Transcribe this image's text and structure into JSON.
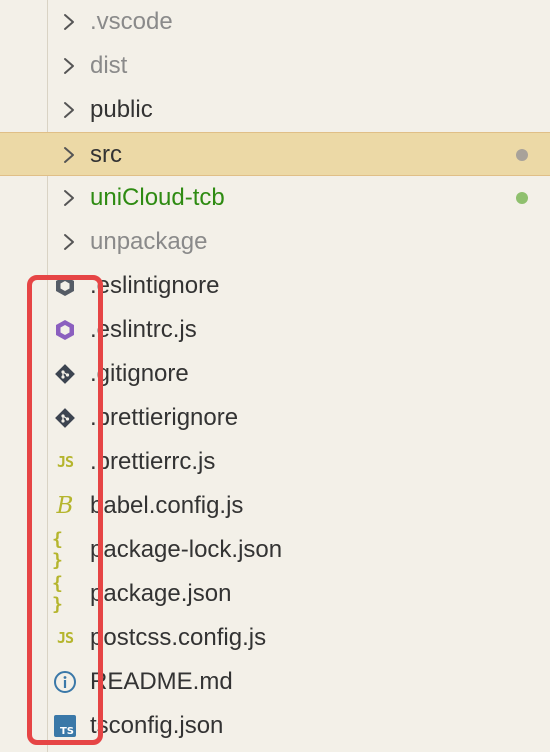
{
  "explorer": {
    "rows": [
      {
        "label": "⁠.vscode",
        "kind": "folder",
        "color": "#8a8a8a"
      },
      {
        "label": "dist",
        "kind": "folder",
        "color": "#8a8a8a"
      },
      {
        "label": "public",
        "kind": "folder",
        "color": "#333333"
      },
      {
        "label": "src",
        "kind": "folder",
        "color": "#333333",
        "selected": true,
        "dot": "#a8a29a"
      },
      {
        "label": "uniCloud-tcb",
        "kind": "folder",
        "color": "#2e8b12",
        "dot": "#8fc06e"
      },
      {
        "label": "unpackage",
        "kind": "folder",
        "color": "#8a8a8a"
      },
      {
        "label": ".eslintignore",
        "kind": "file",
        "icon": "eslint-ignore-icon",
        "color": "#333333"
      },
      {
        "label": ".eslintrc.js",
        "kind": "file",
        "icon": "eslint-icon",
        "color": "#333333"
      },
      {
        "label": ".gitignore",
        "kind": "file",
        "icon": "git-icon",
        "color": "#333333"
      },
      {
        "label": ".prettierignore",
        "kind": "file",
        "icon": "git-icon",
        "color": "#333333"
      },
      {
        "label": ".prettierrc.js",
        "kind": "file",
        "icon": "javascript-icon",
        "color": "#333333"
      },
      {
        "label": "babel.config.js",
        "kind": "file",
        "icon": "babel-icon",
        "color": "#333333"
      },
      {
        "label": "package-lock.json",
        "kind": "file",
        "icon": "json-icon",
        "color": "#333333"
      },
      {
        "label": "package.json",
        "kind": "file",
        "icon": "json-icon",
        "color": "#333333"
      },
      {
        "label": "postcss.config.js",
        "kind": "file",
        "icon": "javascript-icon",
        "color": "#333333"
      },
      {
        "label": "README.md",
        "kind": "file",
        "icon": "info-icon",
        "color": "#333333"
      },
      {
        "label": "tsconfig.json",
        "kind": "file",
        "icon": "typescript-icon",
        "color": "#333333"
      }
    ],
    "icon_text": {
      "js": "JS",
      "braces": "{ }",
      "babel": "B",
      "ts": "TS"
    },
    "colors": {
      "selection": "#ecd9a6",
      "annotation": "#e64545",
      "icon_yellow": "#b5b52d",
      "eslint_purple": "#8b5fbf"
    }
  }
}
